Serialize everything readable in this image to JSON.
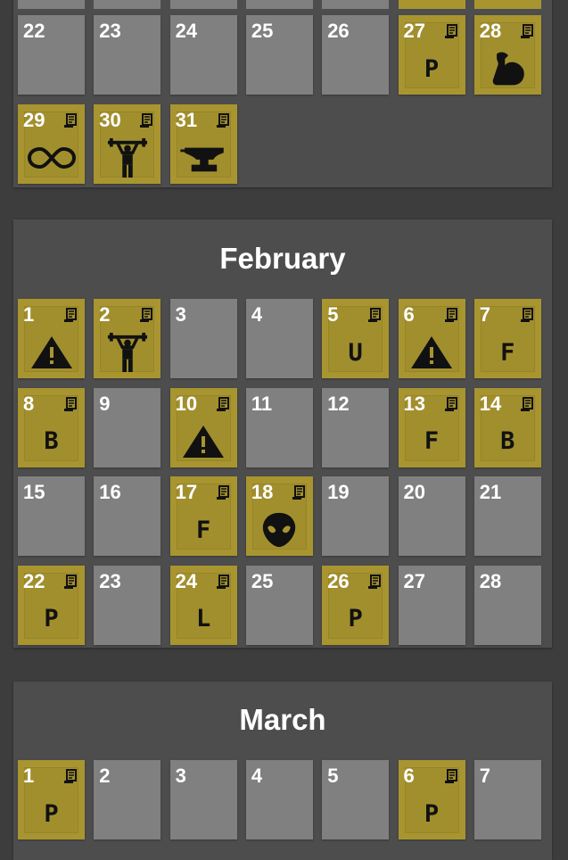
{
  "colors": {
    "background": "#3d3d3d",
    "card": "#4d4d4d",
    "day_empty": "#808080",
    "day_logged": "#a89530",
    "text": "#ffffff",
    "icon": "#111111"
  },
  "months": [
    {
      "name": "",
      "days": [
        {
          "day": "22",
          "logged": false
        },
        {
          "day": "23",
          "logged": false
        },
        {
          "day": "24",
          "logged": false
        },
        {
          "day": "25",
          "logged": false
        },
        {
          "day": "26",
          "logged": false
        },
        {
          "day": "27",
          "logged": true,
          "mark": "P"
        },
        {
          "day": "28",
          "logged": true,
          "icon": "flexed-arm-icon"
        },
        {
          "day": "29",
          "logged": true,
          "icon": "infinity-icon"
        },
        {
          "day": "30",
          "logged": true,
          "icon": "weightlifter-icon"
        },
        {
          "day": "31",
          "logged": true,
          "icon": "anvil-icon"
        }
      ]
    },
    {
      "name": "February",
      "days": [
        {
          "day": "1",
          "logged": true,
          "icon": "warning-icon"
        },
        {
          "day": "2",
          "logged": true,
          "icon": "weightlifter-icon"
        },
        {
          "day": "3",
          "logged": false
        },
        {
          "day": "4",
          "logged": false
        },
        {
          "day": "5",
          "logged": true,
          "mark": "U"
        },
        {
          "day": "6",
          "logged": true,
          "icon": "warning-icon"
        },
        {
          "day": "7",
          "logged": true,
          "mark": "F"
        },
        {
          "day": "8",
          "logged": true,
          "mark": "B"
        },
        {
          "day": "9",
          "logged": false
        },
        {
          "day": "10",
          "logged": true,
          "icon": "warning-icon"
        },
        {
          "day": "11",
          "logged": false
        },
        {
          "day": "12",
          "logged": false
        },
        {
          "day": "13",
          "logged": true,
          "mark": "F"
        },
        {
          "day": "14",
          "logged": true,
          "mark": "B"
        },
        {
          "day": "15",
          "logged": false
        },
        {
          "day": "16",
          "logged": false
        },
        {
          "day": "17",
          "logged": true,
          "mark": "F"
        },
        {
          "day": "18",
          "logged": true,
          "icon": "alien-icon"
        },
        {
          "day": "19",
          "logged": false
        },
        {
          "day": "20",
          "logged": false
        },
        {
          "day": "21",
          "logged": false
        },
        {
          "day": "22",
          "logged": true,
          "mark": "P"
        },
        {
          "day": "23",
          "logged": false
        },
        {
          "day": "24",
          "logged": true,
          "mark": "L"
        },
        {
          "day": "25",
          "logged": false
        },
        {
          "day": "26",
          "logged": true,
          "mark": "P"
        },
        {
          "day": "27",
          "logged": false
        },
        {
          "day": "28",
          "logged": false
        }
      ]
    },
    {
      "name": "March",
      "days": [
        {
          "day": "1",
          "logged": true,
          "mark": "P"
        },
        {
          "day": "2",
          "logged": false
        },
        {
          "day": "3",
          "logged": false
        },
        {
          "day": "4",
          "logged": false
        },
        {
          "day": "5",
          "logged": false
        },
        {
          "day": "6",
          "logged": true,
          "mark": "P"
        },
        {
          "day": "7",
          "logged": false
        }
      ]
    }
  ]
}
